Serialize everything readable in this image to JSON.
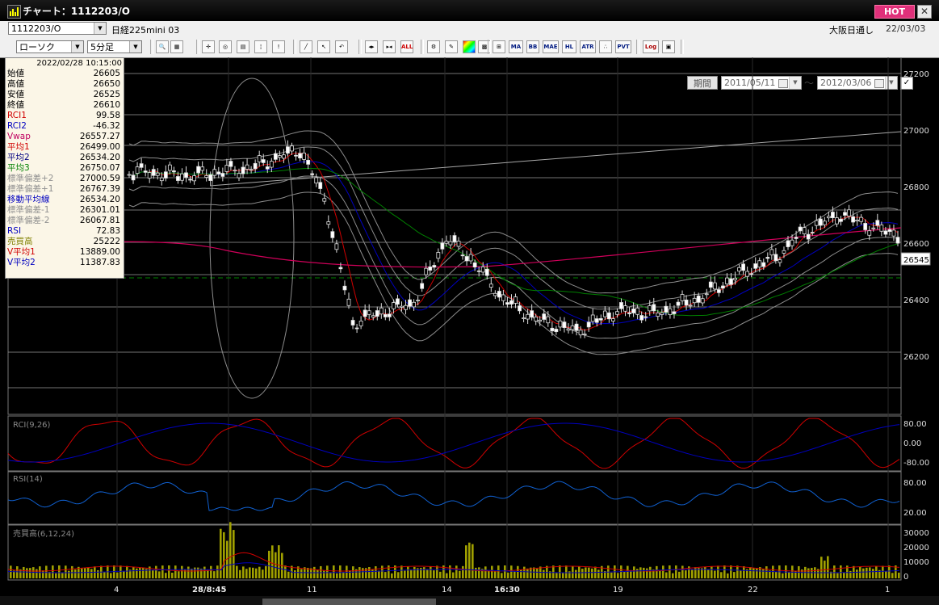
{
  "window": {
    "title": "チャート：1112203/O",
    "hot_label": "HOT",
    "close_glyph": "✕"
  },
  "symbol": {
    "code": "1112203/O",
    "name": "日経225mini 03",
    "session": "大阪日通し",
    "date": "22/03/03"
  },
  "controls": {
    "chart_type": "ローソク",
    "interval": "5分足",
    "period_label": "期間",
    "date_from": "2011/05/11",
    "date_to": "2012/03/06",
    "tilde": "〜"
  },
  "toolbar_text_buttons": [
    "MA",
    "BB",
    "MAE",
    "HL",
    "ATR",
    "PVT",
    "Log",
    "ALL"
  ],
  "info_panel": {
    "datetime": "2022/02/28 10:15:00",
    "rows": [
      {
        "label": "始値",
        "value": "26605",
        "color": "#000000"
      },
      {
        "label": "高値",
        "value": "26650",
        "color": "#000000"
      },
      {
        "label": "安値",
        "value": "26525",
        "color": "#000000"
      },
      {
        "label": "終値",
        "value": "26610",
        "color": "#000000"
      },
      {
        "label": "RCI1",
        "value": "99.58",
        "color": "#d00000"
      },
      {
        "label": "RCI2",
        "value": "-46.32",
        "color": "#0000c0"
      },
      {
        "label": "Vwap",
        "value": "26557.27",
        "color": "#c00060"
      },
      {
        "label": "平均1",
        "value": "26499.00",
        "color": "#d00000"
      },
      {
        "label": "平均2",
        "value": "26534.20",
        "color": "#000080"
      },
      {
        "label": "平均3",
        "value": "26750.07",
        "color": "#008000"
      },
      {
        "label": "標準偏差+2",
        "value": "27000.59",
        "color": "#909090"
      },
      {
        "label": "標準偏差+1",
        "value": "26767.39",
        "color": "#909090"
      },
      {
        "label": "移動平均線",
        "value": "26534.20",
        "color": "#0000c0"
      },
      {
        "label": "標準偏差-1",
        "value": "26301.01",
        "color": "#909090"
      },
      {
        "label": "標準偏差-2",
        "value": "26067.81",
        "color": "#909090"
      },
      {
        "label": "RSI",
        "value": "72.83",
        "color": "#0000c0"
      },
      {
        "label": "売買高",
        "value": "25222",
        "color": "#808000"
      },
      {
        "label": "V平均1",
        "value": "13889.00",
        "color": "#d00000"
      },
      {
        "label": "V平均2",
        "value": "11387.83",
        "color": "#0000c0"
      }
    ]
  },
  "price_panel": {
    "y_ticks": [
      "27200",
      "27000",
      "26800",
      "26600",
      "26400",
      "26200"
    ],
    "last_price": "26545"
  },
  "rci_panel": {
    "label": "RCI(9,26)",
    "ticks": [
      "80.00",
      "0.00",
      "-80.00"
    ]
  },
  "rsi_panel": {
    "label": "RSI(14)",
    "ticks": [
      "80.00",
      "20.00"
    ]
  },
  "volume_panel": {
    "label": "売買高(6,12,24)",
    "ticks": [
      "30000",
      "20000",
      "10000",
      "0"
    ]
  },
  "x_axis": {
    "labels": [
      "4",
      "28/8:45",
      "11",
      "14",
      "16:30",
      "19",
      "22",
      "1"
    ]
  },
  "colors": {
    "background": "#000000",
    "grid": "#2e2e2e",
    "candle_up": "#ffffff",
    "candle_down": "#000000",
    "ma1": "#d00000",
    "ma2": "#0000c0",
    "ma3": "#008000",
    "vwap": "#d0005a",
    "bands": "#8c8c8c",
    "rci1": "#d00000",
    "rci2": "#0000c0",
    "rsi": "#1060d0",
    "volume": "#a0a000",
    "dashed_level": "#008000"
  }
}
